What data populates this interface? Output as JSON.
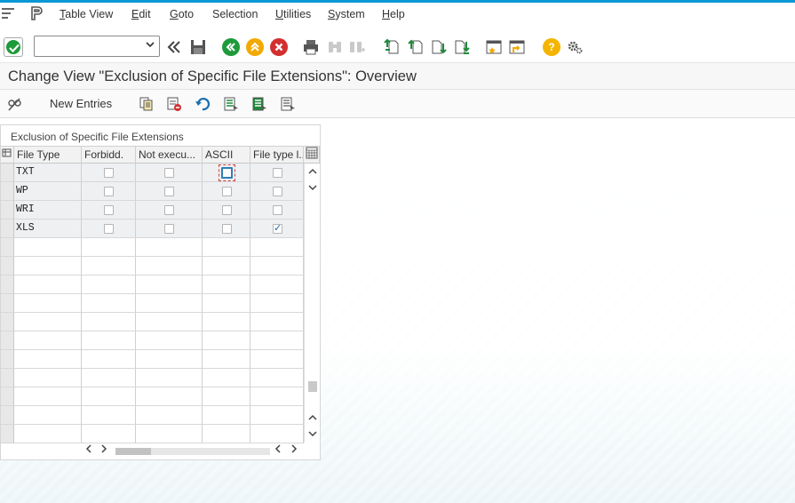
{
  "menu": {
    "items": [
      {
        "label": "Table View",
        "underline": "T",
        "rest": "able View"
      },
      {
        "label": "Edit",
        "underline": "E",
        "rest": "dit"
      },
      {
        "label": "Goto",
        "underline": "G",
        "rest": "oto"
      },
      {
        "label": "Selection",
        "underline": "",
        "rest": "Selection"
      },
      {
        "label": "Utilities",
        "underline": "U",
        "rest": "tilities"
      },
      {
        "label": "System",
        "underline": "S",
        "rest": "ystem"
      },
      {
        "label": "Help",
        "underline": "H",
        "rest": "elp"
      }
    ]
  },
  "toolbar": {
    "command_field_value": "",
    "icons": [
      "ok-icon",
      "back-double-icon",
      "save-icon",
      "back-icon",
      "exit-icon",
      "cancel-icon",
      "print-icon",
      "find-icon",
      "find-next-icon",
      "first-page-icon",
      "prev-page-icon",
      "next-page-icon",
      "last-page-icon",
      "new-session-icon",
      "shortcut-icon",
      "help-icon",
      "settings-icon"
    ]
  },
  "page": {
    "title": "Change View \"Exclusion of Specific File Extensions\": Overview"
  },
  "app_toolbar": {
    "new_entries_label": "New Entries"
  },
  "table": {
    "caption": "Exclusion of Specific File Extensions",
    "columns": [
      "File Type",
      "Forbidd.",
      "Not execu...",
      "ASCII",
      "File type l..."
    ],
    "rows": [
      {
        "file_type": "TXT",
        "forbidden": false,
        "not_executable": false,
        "ascii": false,
        "file_type_l": false
      },
      {
        "file_type": "WP",
        "forbidden": false,
        "not_executable": false,
        "ascii": false,
        "file_type_l": false
      },
      {
        "file_type": "WRI",
        "forbidden": false,
        "not_executable": false,
        "ascii": false,
        "file_type_l": false
      },
      {
        "file_type": "XLS",
        "forbidden": false,
        "not_executable": false,
        "ascii": false,
        "file_type_l": true
      }
    ],
    "empty_rows": 11
  },
  "colors": {
    "accent": "#0a98d6",
    "ok_green": "#1e9a3a",
    "nav_yellow": "#f2a900",
    "cancel_red": "#d32f2f",
    "help_orange": "#f4b400"
  }
}
